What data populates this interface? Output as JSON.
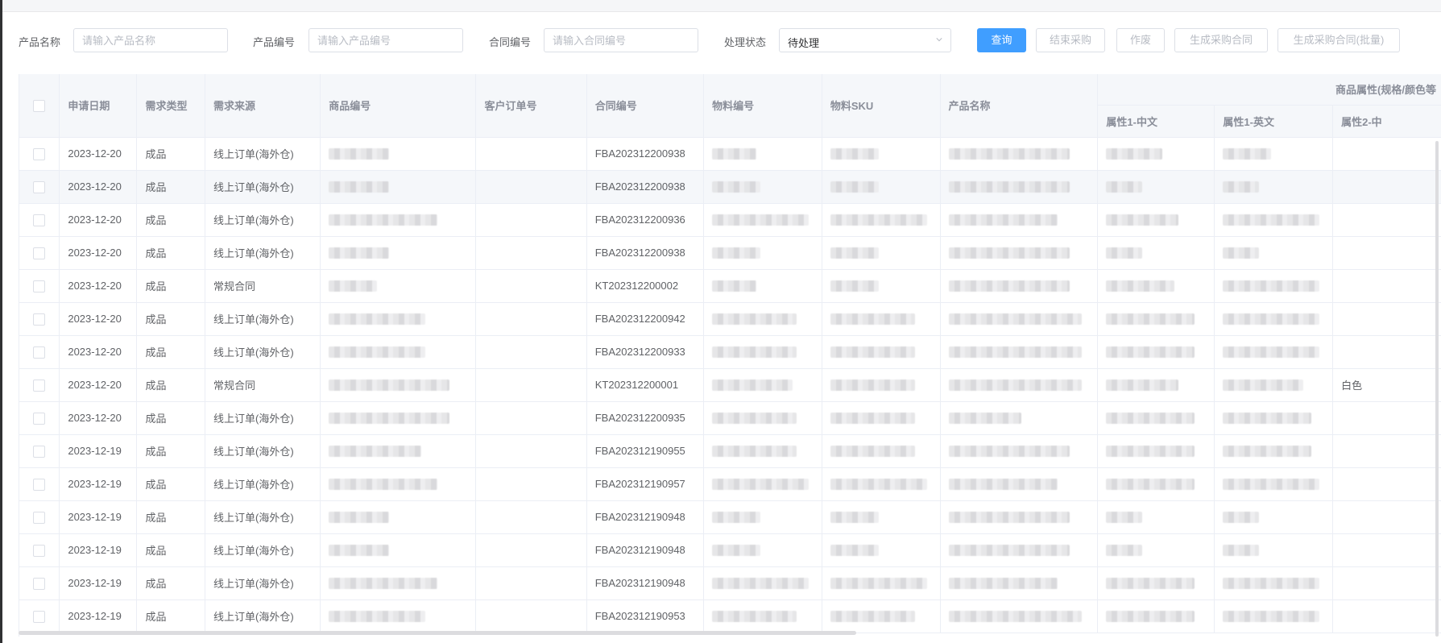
{
  "filters": {
    "product_name_label": "产品名称",
    "product_name_placeholder": "请输入产品名称",
    "product_code_label": "产品编号",
    "product_code_placeholder": "请输入产品编号",
    "contract_code_label": "合同编号",
    "contract_code_placeholder": "请输入合同编号",
    "status_label": "处理状态",
    "status_value": "待处理"
  },
  "buttons": {
    "query": "查询",
    "end_purchase": "结束采购",
    "void": "作废",
    "gen_contract": "生成采购合同",
    "gen_contract_batch": "生成采购合同(批量)"
  },
  "table": {
    "headers": {
      "apply_date": "申请日期",
      "demand_type": "需求类型",
      "demand_source": "需求来源",
      "product_code": "商品编号",
      "customer_order": "客户订单号",
      "contract_no": "合同编号",
      "material_code": "物料编号",
      "material_sku": "物料SKU",
      "product_name": "产品名称",
      "attr_group": "商品属性(规格/颜色等",
      "attr1_cn": "属性1-中文",
      "attr1_en": "属性1-英文",
      "attr2_cn": "属性2-中"
    },
    "rows": [
      {
        "date": "2023-12-20",
        "type": "成品",
        "source": "线上订单(海外仓)",
        "contract": "FBA202312200938",
        "attr2": ""
      },
      {
        "date": "2023-12-20",
        "type": "成品",
        "source": "线上订单(海外仓)",
        "contract": "FBA202312200938",
        "attr2": ""
      },
      {
        "date": "2023-12-20",
        "type": "成品",
        "source": "线上订单(海外仓)",
        "contract": "FBA202312200936",
        "attr2": ""
      },
      {
        "date": "2023-12-20",
        "type": "成品",
        "source": "线上订单(海外仓)",
        "contract": "FBA202312200938",
        "attr2": ""
      },
      {
        "date": "2023-12-20",
        "type": "成品",
        "source": "常规合同",
        "contract": "KT202312200002",
        "attr2": ""
      },
      {
        "date": "2023-12-20",
        "type": "成品",
        "source": "线上订单(海外仓)",
        "contract": "FBA202312200942",
        "attr2": ""
      },
      {
        "date": "2023-12-20",
        "type": "成品",
        "source": "线上订单(海外仓)",
        "contract": "FBA202312200933",
        "attr2": ""
      },
      {
        "date": "2023-12-20",
        "type": "成品",
        "source": "常规合同",
        "contract": "KT202312200001",
        "attr2": "白色"
      },
      {
        "date": "2023-12-20",
        "type": "成品",
        "source": "线上订单(海外仓)",
        "contract": "FBA202312200935",
        "attr2": ""
      },
      {
        "date": "2023-12-19",
        "type": "成品",
        "source": "线上订单(海外仓)",
        "contract": "FBA202312190955",
        "attr2": ""
      },
      {
        "date": "2023-12-19",
        "type": "成品",
        "source": "线上订单(海外仓)",
        "contract": "FBA202312190957",
        "attr2": ""
      },
      {
        "date": "2023-12-19",
        "type": "成品",
        "source": "线上订单(海外仓)",
        "contract": "FBA202312190948",
        "attr2": ""
      },
      {
        "date": "2023-12-19",
        "type": "成品",
        "source": "线上订单(海外仓)",
        "contract": "FBA202312190948",
        "attr2": ""
      },
      {
        "date": "2023-12-19",
        "type": "成品",
        "source": "线上订单(海外仓)",
        "contract": "FBA202312190948",
        "attr2": ""
      },
      {
        "date": "2023-12-19",
        "type": "成品",
        "source": "线上订单(海外仓)",
        "contract": "FBA202312190953",
        "attr2": ""
      }
    ]
  },
  "icons": {
    "status_select": "chevron-down-icon",
    "checkbox": "checkbox-icon"
  },
  "colors": {
    "primary": "#409eff",
    "header_bg": "#f5f7fa",
    "border": "#ebeef5"
  }
}
